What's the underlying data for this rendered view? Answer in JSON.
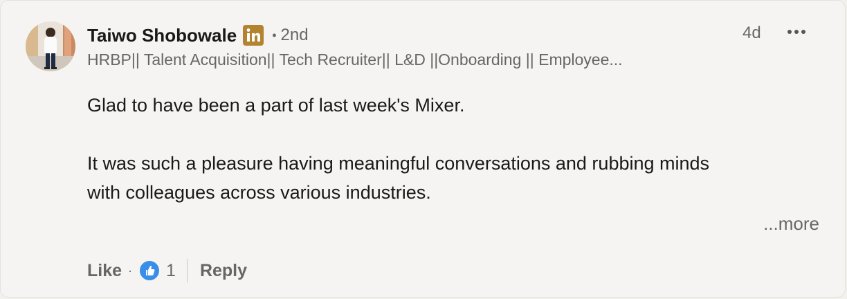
{
  "comment": {
    "author": {
      "name": "Taiwo Shobowale",
      "badge_icon": "linkedin-premium-icon",
      "connection_degree": "2nd",
      "headline": "HRBP|| Talent Acquisition|| Tech Recruiter|| L&D ||Onboarding || Employee..."
    },
    "timestamp": "4d",
    "menu_icon": "more-horizontal-icon",
    "body": {
      "paragraph_1": "Glad to have been a part of last week's Mixer.",
      "paragraph_2_line_1": "It was such a pleasure having meaningful conversations and rubbing minds",
      "paragraph_2_line_2": "with colleagues across various industries."
    },
    "see_more_label": "...more",
    "actions": {
      "like_label": "Like",
      "reaction_icon": "like-reaction-icon",
      "reaction_count": "1",
      "reply_label": "Reply"
    },
    "colors": {
      "badge": "#b38330",
      "reaction": "#378fe9"
    }
  }
}
